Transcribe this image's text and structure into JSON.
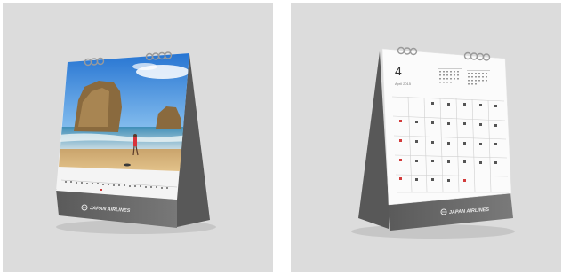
{
  "left_photo": {
    "brand": "JAPAN AIRLINES",
    "icon": "crane-logo-icon"
  },
  "right_photo": {
    "month_number": "4",
    "month_caption": "April 2015",
    "brand": "JAPAN AIRLINES",
    "icon": "crane-logo-icon"
  },
  "colors": {
    "panel_bg": "#dcdcdc",
    "stand_gray": "#6b6b6b",
    "stand_dark": "#4e4e4e",
    "sky": "#2b7fd6",
    "sand": "#d9b57a",
    "sunday_red": "#d23b3b"
  }
}
